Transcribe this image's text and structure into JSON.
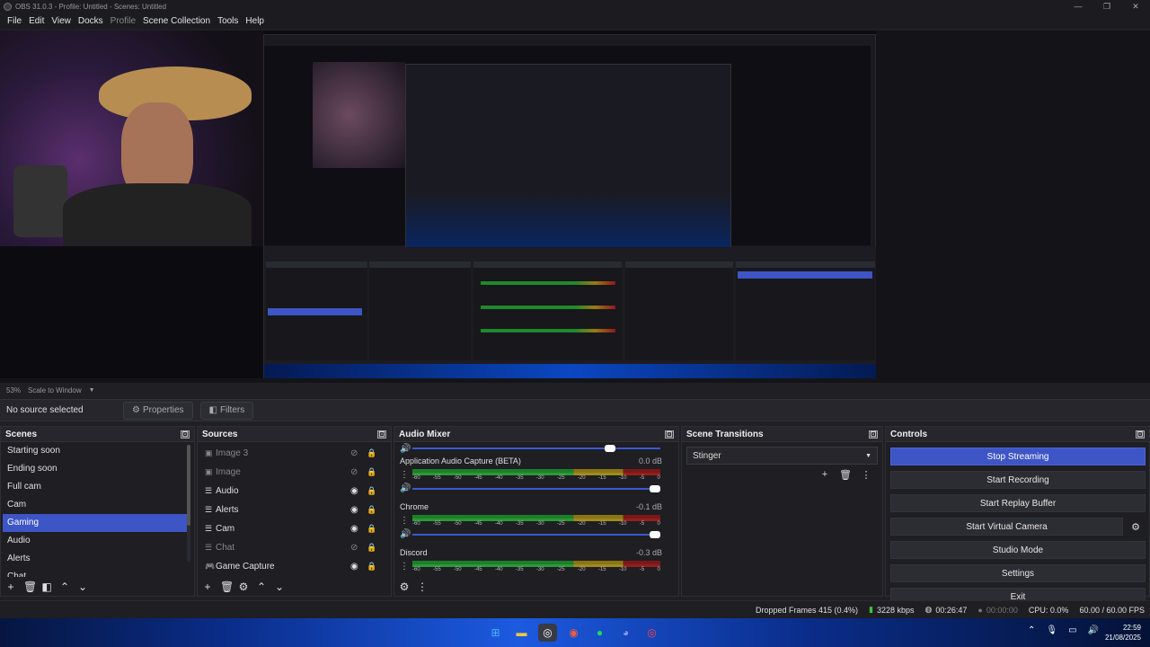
{
  "window": {
    "title": "OBS 31.0.3 - Profile: Untitled - Scenes: Untitled",
    "controls": [
      "—",
      "❐",
      "✕"
    ]
  },
  "menu": {
    "items": [
      "File",
      "Edit",
      "View",
      "Docks",
      "Profile",
      "Scene Collection",
      "Tools",
      "Help"
    ]
  },
  "preview": {
    "zoom": "53%",
    "scale_mode": "Scale to Window"
  },
  "source_bar": {
    "no_source": "No source selected",
    "properties": "Properties",
    "filters": "Filters"
  },
  "scenes": {
    "title": "Scenes",
    "items": [
      "Starting soon",
      "Ending soon",
      "Full cam",
      "Cam",
      "Gaming",
      "Audio",
      "Alerts",
      "Chat"
    ],
    "selected": "Gaming"
  },
  "sources": {
    "title": "Sources",
    "items": [
      {
        "name": "Image 3",
        "icon": "image-icon",
        "visible": false
      },
      {
        "name": "Image",
        "icon": "image-icon",
        "visible": false
      },
      {
        "name": "Audio",
        "icon": "group-icon",
        "visible": true
      },
      {
        "name": "Alerts",
        "icon": "group-icon",
        "visible": true
      },
      {
        "name": "Cam",
        "icon": "group-icon",
        "visible": true
      },
      {
        "name": "Chat",
        "icon": "group-icon",
        "visible": false
      },
      {
        "name": "Game Capture",
        "icon": "gamepad-icon",
        "visible": true
      }
    ]
  },
  "mixer": {
    "title": "Audio Mixer",
    "channels": [
      {
        "name": "Application Audio Capture (BETA)",
        "db": "0.0 dB"
      },
      {
        "name": "Chrome",
        "db": "-0.1 dB"
      },
      {
        "name": "Discord",
        "db": "-0.3 dB"
      }
    ],
    "ticks": [
      "-60",
      "-55",
      "-50",
      "-45",
      "-40",
      "-35",
      "-30",
      "-25",
      "-20",
      "-15",
      "-10",
      "-5",
      "0"
    ]
  },
  "transitions": {
    "title": "Scene Transitions",
    "selected": "Stinger"
  },
  "controls": {
    "title": "Controls",
    "stop_streaming": "Stop Streaming",
    "start_recording": "Start Recording",
    "start_replay_buffer": "Start Replay Buffer",
    "start_virtual_camera": "Start Virtual Camera",
    "studio_mode": "Studio Mode",
    "settings": "Settings",
    "exit": "Exit"
  },
  "status": {
    "dropped_frames": "Dropped Frames 415 (0.4%)",
    "bitrate": "3228 kbps",
    "stream_time": "00:26:47",
    "rec_time": "00:00:00",
    "cpu": "CPU: 0.0%",
    "fps": "60.00 / 60.00 FPS"
  },
  "taskbar": {
    "time": "22:59",
    "date": "21/08/2025"
  },
  "colors": {
    "accent": "#3d55c5",
    "meter_green": "#1d7e2a",
    "meter_yellow": "#8a7414",
    "meter_red": "#7a1818"
  }
}
